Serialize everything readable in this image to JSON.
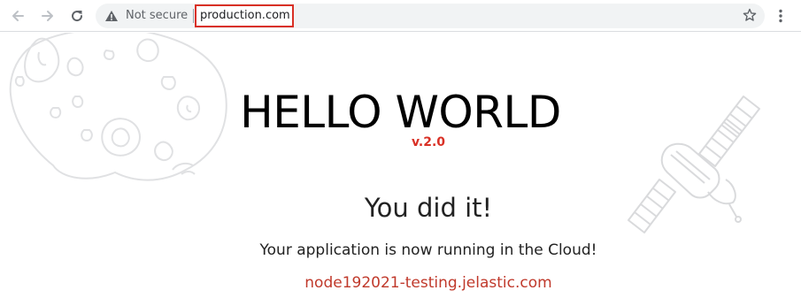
{
  "browser": {
    "security_label": "Not secure",
    "url": "production.com",
    "icons": {
      "back": "back-arrow-icon",
      "forward": "forward-arrow-icon",
      "reload": "reload-icon",
      "security": "warning-triangle-icon",
      "bookmark": "star-icon",
      "menu": "kebab-menu-icon"
    },
    "url_highlight_color": "#d93025"
  },
  "page": {
    "title": "HELLO WORLD",
    "version": "v.2.0",
    "headline": "You did it!",
    "message": "Your application is now running in the Cloud!",
    "hostname": "node192021-testing.jelastic.com",
    "accent_color": "#d93025"
  }
}
